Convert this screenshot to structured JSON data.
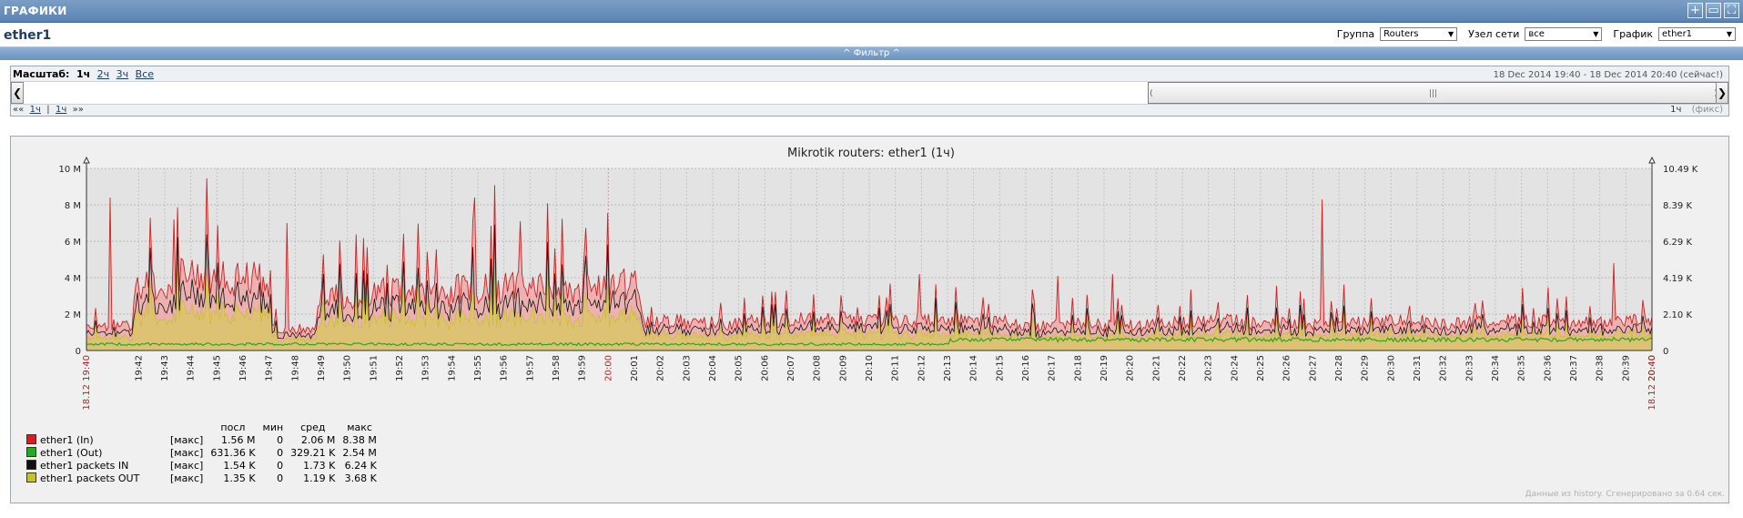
{
  "window": {
    "title": "ГРАФИКИ",
    "buttons": [
      "+",
      "▭",
      "⛶"
    ]
  },
  "header": {
    "page_title": "ether1",
    "group_label": "Группа",
    "group_value": "Routers",
    "host_label": "Узел сети",
    "host_value": "все",
    "graph_label": "График",
    "graph_value": "ether1"
  },
  "filter": {
    "label": "^ Фильтр ^"
  },
  "scale": {
    "label": "Масштаб:",
    "options": [
      "1ч",
      "2ч",
      "3ч",
      "Все"
    ],
    "date_range": "18 Dec 2014 19:40  -  18 Dec 2014 20:40 (сейчас!)",
    "nav_prev": "««",
    "nav_1h_back": "1ч",
    "nav_sep": "|",
    "nav_1h_fwd": "1ч",
    "nav_next": "»»",
    "period": "1ч",
    "fix": "(фикс)"
  },
  "chart_data": {
    "type": "area",
    "title": "Mikrotik routers: ether1 (1ч)",
    "yaxis_left": {
      "ticks": [
        "0",
        "2 M",
        "4 M",
        "6 M",
        "8 M",
        "10 M"
      ],
      "ylim": [
        0,
        10000000
      ]
    },
    "yaxis_right": {
      "ticks": [
        "0",
        "2.10 K",
        "4.19 K",
        "6.29 K",
        "8.39 K",
        "10.49 K"
      ],
      "ylim": [
        0,
        10490
      ]
    },
    "x_ticks": [
      "19:42",
      "19:43",
      "19:44",
      "19:45",
      "19:46",
      "19:47",
      "19:48",
      "19:49",
      "19:50",
      "19:51",
      "19:52",
      "19:53",
      "19:54",
      "19:55",
      "19:56",
      "19:57",
      "19:58",
      "19:59",
      "20:00",
      "20:01",
      "20:02",
      "20:03",
      "20:04",
      "20:05",
      "20:06",
      "20:07",
      "20:08",
      "20:09",
      "20:10",
      "20:11",
      "20:12",
      "20:13",
      "20:14",
      "20:15",
      "20:16",
      "20:17",
      "20:18",
      "20:19",
      "20:20",
      "20:21",
      "20:22",
      "20:23",
      "20:24",
      "20:25",
      "20:26",
      "20:27",
      "20:28",
      "20:29",
      "20:30",
      "20:31",
      "20:32",
      "20:33",
      "20:34",
      "20:35",
      "20:36",
      "20:37",
      "20:38",
      "20:39",
      "20:40"
    ],
    "x_start_label": "18.12 19:40",
    "x_end_label": "18.12 20:40",
    "grid": true,
    "series": [
      {
        "name": "ether1 (In)",
        "color": "#cc2222",
        "fill": "#eea8a8",
        "last": "1.56 M",
        "min": "0",
        "avg": "2.06 M",
        "max": "8.38 M",
        "segment_levels": [
          1.4,
          3.6,
          4.1,
          3.9,
          1.2,
          3.0,
          3.2,
          3.1,
          3.4,
          3.5,
          3.4,
          3.6,
          1.6,
          1.5,
          1.6,
          1.7,
          1.7,
          1.6,
          1.7,
          1.6,
          1.4,
          1.5,
          1.4,
          1.5,
          1.6,
          1.5,
          1.4,
          1.5,
          1.6,
          1.5,
          1.6,
          1.6,
          1.5,
          1.6
        ]
      },
      {
        "name": "ether1 (Out)",
        "color": "#22aa22",
        "last": "631.36 K",
        "min": "0",
        "avg": "329.21 K",
        "max": "2.54 M"
      },
      {
        "name": "ether1 packets IN",
        "color": "#111111",
        "last": "1.54 K",
        "min": "0",
        "avg": "1.73 K",
        "max": "6.24 K"
      },
      {
        "name": "ether1 packets OUT",
        "color": "#c8c030",
        "last": "1.35 K",
        "min": "0",
        "avg": "1.19 K",
        "max": "3.68 K"
      }
    ],
    "legend_headers": [
      "посл",
      "мин",
      "сред",
      "макс"
    ],
    "legend_type": "[макс]"
  },
  "footer": {
    "note": "Данные из history. Сгенерировано за 0.64 сек."
  }
}
